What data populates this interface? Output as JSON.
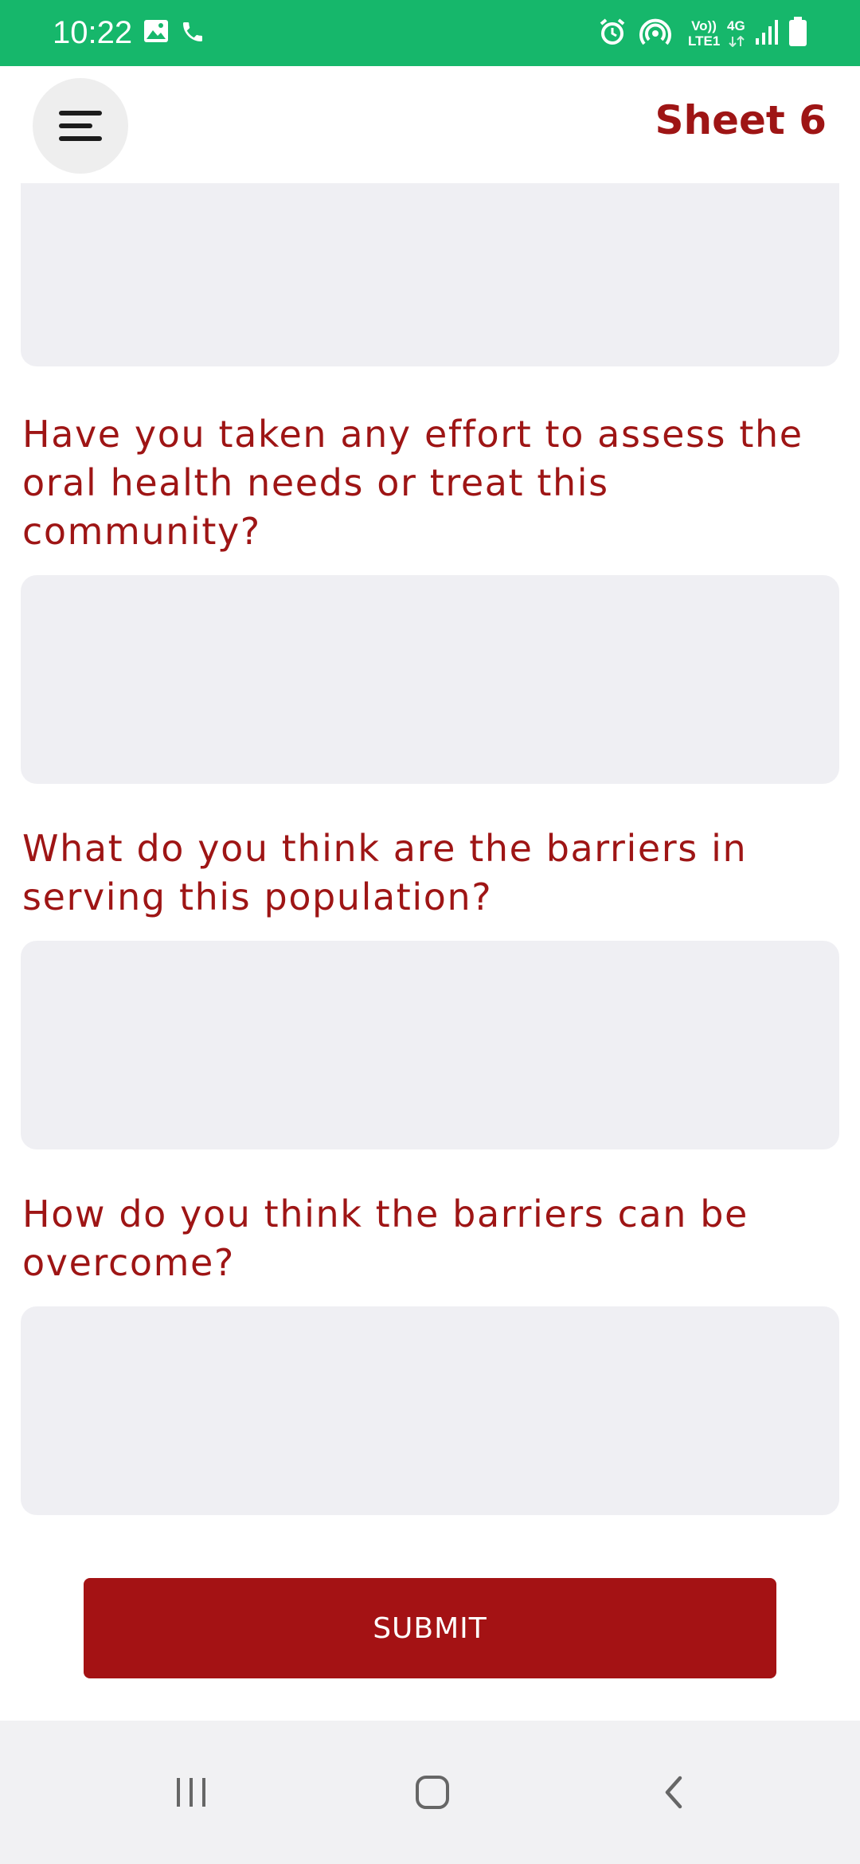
{
  "status_bar": {
    "time": "10:22",
    "left_icons": [
      "image-icon",
      "phone-icon"
    ],
    "right_icons": [
      "alarm-icon",
      "hotspot-icon",
      "volte-icon",
      "signal-icon",
      "battery-icon"
    ],
    "volte_top": "Vo))",
    "volte_bottom": "LTE1",
    "network_type": "4G",
    "background_color": "#16b76b"
  },
  "header": {
    "menu_icon": "hamburger-menu-icon",
    "title": "Sheet 6",
    "title_color": "#9e1515"
  },
  "form": {
    "questions": [
      {
        "label": "Have you taken any effort to assess the oral health needs or treat this community?",
        "value": "",
        "placeholder": ""
      },
      {
        "label": "What do you think are the barriers in serving this population?",
        "value": "",
        "placeholder": ""
      },
      {
        "label": "How do you think the barriers can be overcome?",
        "value": "",
        "placeholder": ""
      }
    ],
    "submit_label": "SUBMIT",
    "submit_color": "#a41214"
  },
  "nav_bar": {
    "icons": [
      "recent-apps-icon",
      "home-icon",
      "back-icon"
    ]
  }
}
